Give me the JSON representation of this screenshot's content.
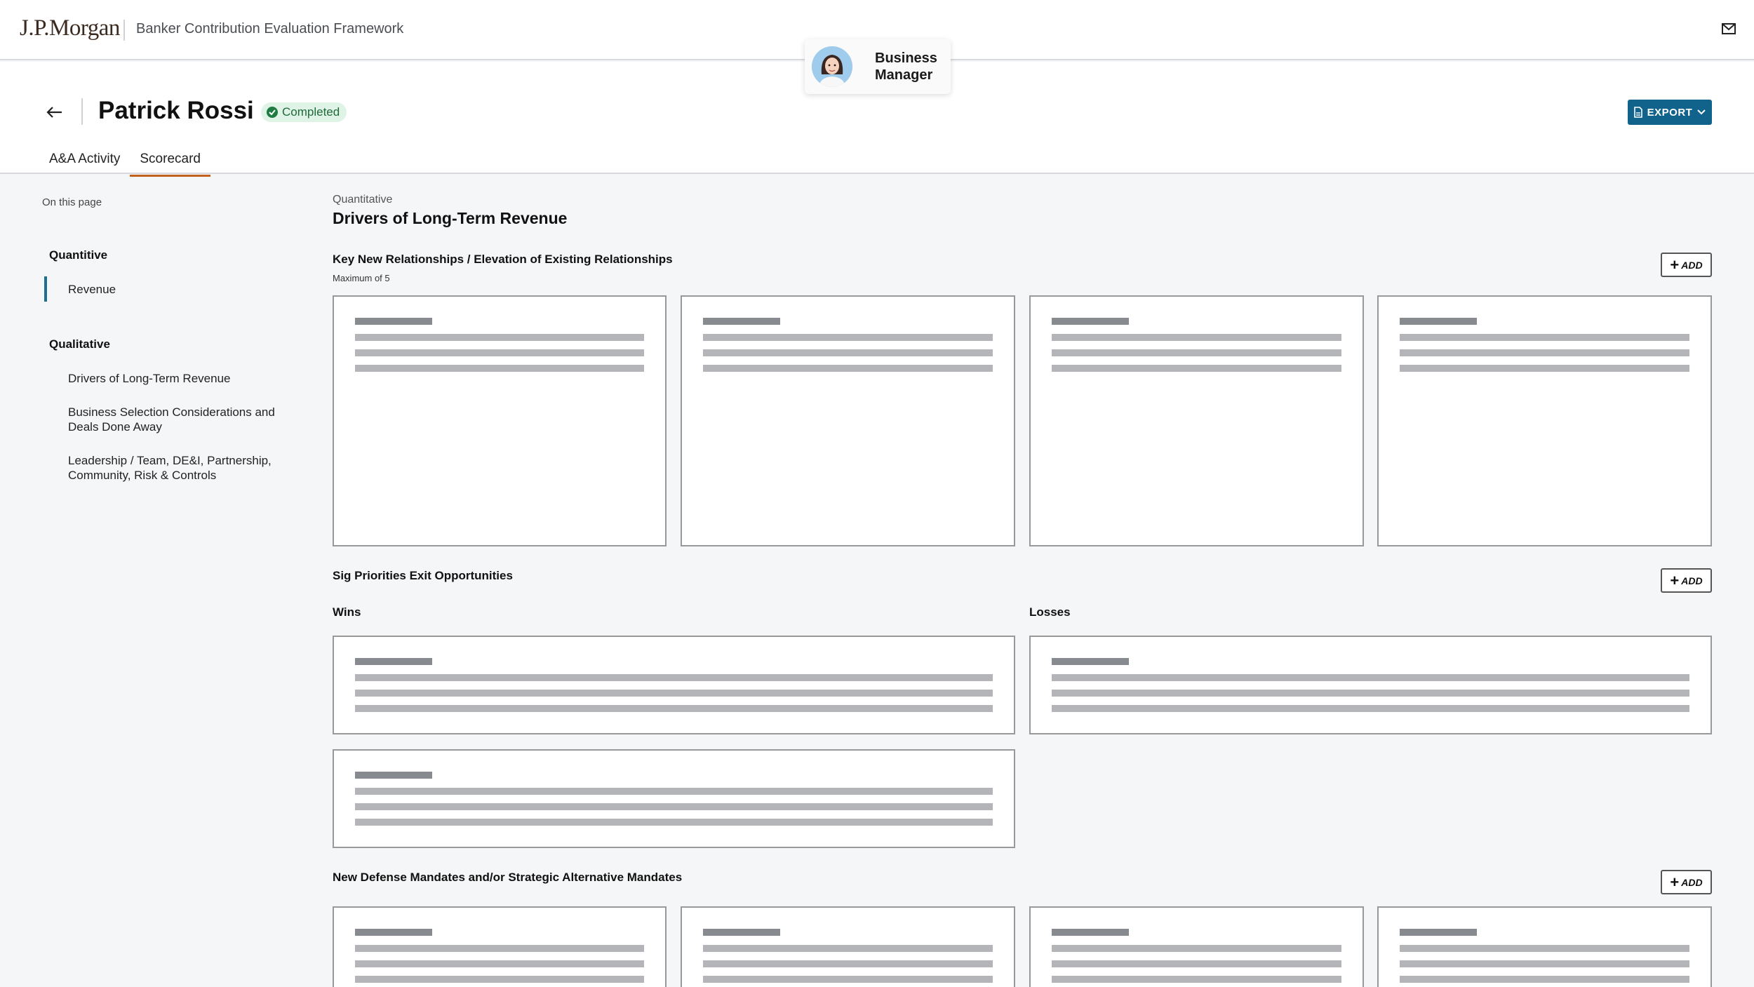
{
  "header": {
    "logo": "J.P.Morgan",
    "app_title": "Banker Contribution Evaluation Framework",
    "role": "Business Manager"
  },
  "page": {
    "name": "Patrick Rossi",
    "status": "Completed",
    "export_label": "EXPORT",
    "tabs": [
      {
        "label": "A&A Activity",
        "active": false
      },
      {
        "label": "Scorecard",
        "active": true
      }
    ]
  },
  "sidebar": {
    "heading": "On this page",
    "groups": [
      {
        "label": "Quantitive",
        "items": [
          {
            "label": "Revenue",
            "active": true
          }
        ]
      },
      {
        "label": "Qualitative",
        "items": [
          {
            "label": "Drivers of Long-Term Revenue",
            "active": false
          },
          {
            "label": "Business Selection Considerations and Deals Done Away",
            "active": false
          },
          {
            "label": "Leadership / Team, DE&I, Partnership, Community, Risk & Controls",
            "active": false
          }
        ]
      }
    ]
  },
  "main": {
    "kicker": "Quantitative",
    "title": "Drivers of Long-Term Revenue",
    "add_label": "ADD",
    "sections": [
      {
        "title": "Key New Relationships / Elevation of Existing Relationships",
        "note": "Maximum of 5"
      },
      {
        "title": "Sig Priorities Exit Opportunities",
        "wins_label": "Wins",
        "losses_label": "Losses"
      },
      {
        "title": "New Defense Mandates and/or Strategic Alternative Mandates"
      }
    ]
  },
  "colors": {
    "accent": "#11638c",
    "tab_underline": "#c2621e",
    "completed_bg": "#dff3e6",
    "completed_fg": "#1e6b3a"
  }
}
